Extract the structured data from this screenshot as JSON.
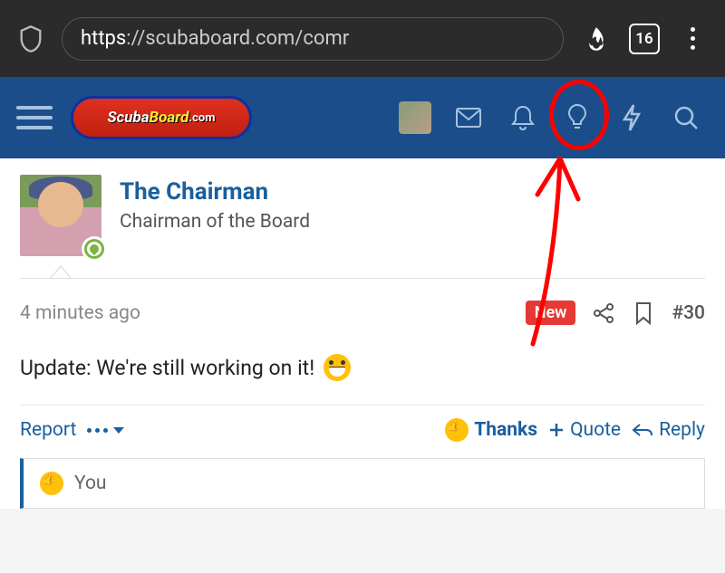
{
  "browser": {
    "url_display": "https://scubaboard.com/comr",
    "tab_count": "16"
  },
  "site": {
    "logo_text_1": "Scuba",
    "logo_text_2": "Board",
    "logo_text_3": ".com"
  },
  "post": {
    "author_name": "The Chairman",
    "author_title": "Chairman of the Board",
    "timestamp": "4 minutes ago",
    "new_badge": "New",
    "post_number": "#30",
    "body_text": "Update: We're still working on it!"
  },
  "actions": {
    "report": "Report",
    "thanks": "Thanks",
    "quote": "Quote",
    "reply": "Reply"
  },
  "reactions": {
    "you_label": "You"
  }
}
